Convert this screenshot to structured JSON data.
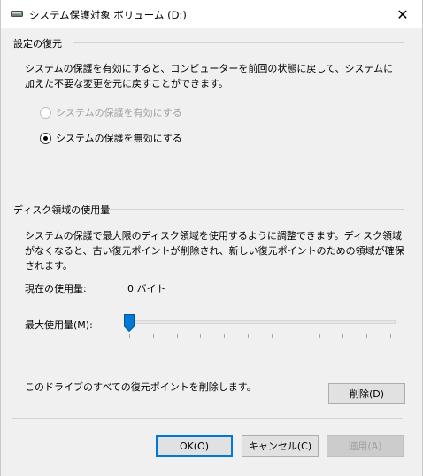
{
  "window": {
    "title": "システム保護対象 ボリューム (D:)",
    "close_glyph": "✕"
  },
  "restore": {
    "group_label": "設定の復元",
    "description": "システムの保護を有効にすると、コンピューターを前回の状態に戻して、システムに加えた不要な変更を元に戻すことができます。",
    "options": [
      {
        "label": "システムの保護を有効にする",
        "selected": false,
        "enabled": false
      },
      {
        "label": "システムの保護を無効にする",
        "selected": true,
        "enabled": true
      }
    ]
  },
  "disk": {
    "group_label": "ディスク領域の使用量",
    "description": "システムの保護で最大限のディスク領域を使用するように調整できます。ディスク領域がなくなると、古い復元ポイントが削除され、新しい復元ポイントのための領域が確保されます。",
    "current_usage_label": "現在の使用量:",
    "current_usage_value": "0 バイト",
    "max_usage_label": "最大使用量(M):",
    "max_usage_fraction": 0
  },
  "delete": {
    "text": "このドライブのすべての復元ポイントを削除します。",
    "button_label": "削除(D)"
  },
  "footer": {
    "ok_label": "OK(O)",
    "cancel_label": "キャンセル(C)",
    "apply_label": "適用(A)"
  },
  "colors": {
    "accent": "#0078d7",
    "disabled_text": "#a0a0a0"
  }
}
